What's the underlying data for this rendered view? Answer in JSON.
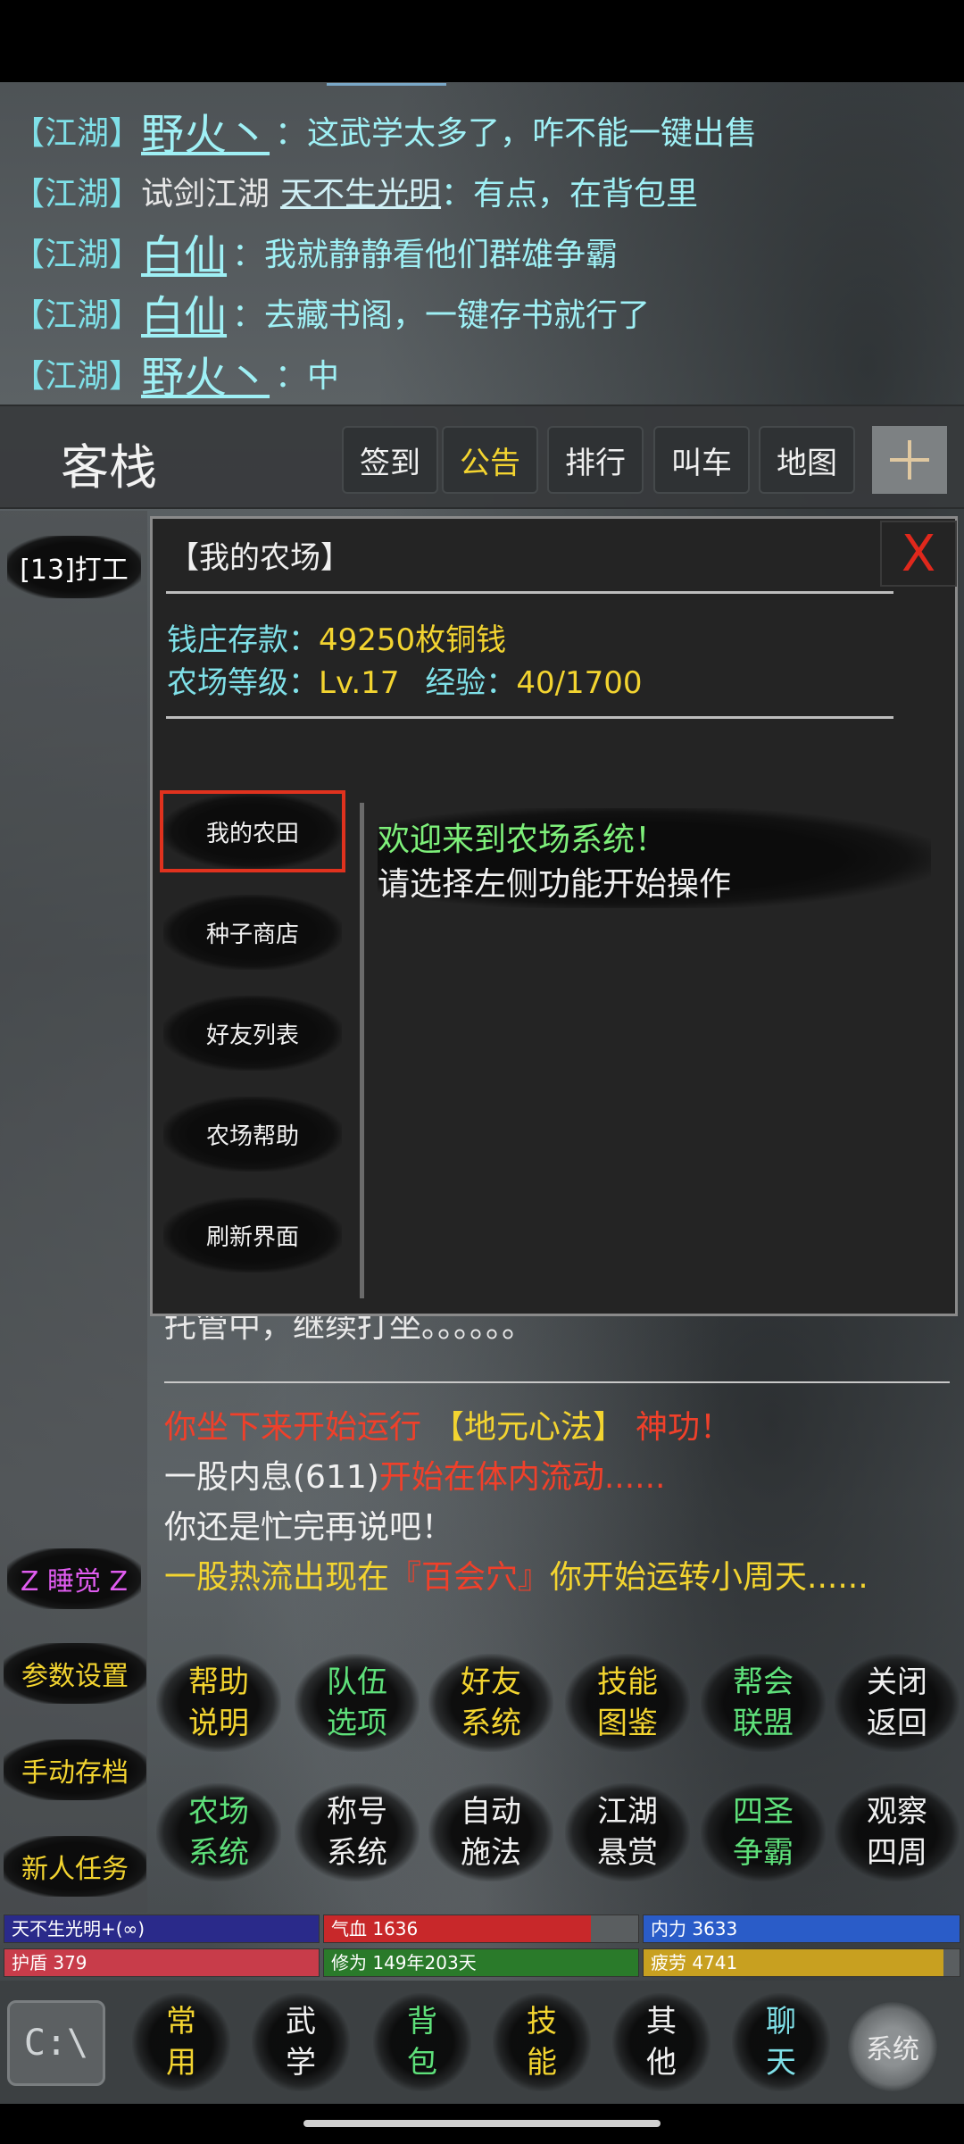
{
  "chat": [
    {
      "channel": "【江湖】",
      "name": "野火丶",
      "message": "：这武学太多了，咋不能一键出售"
    },
    {
      "channel": "【江湖】",
      "prefix": "试剑江湖",
      "name": "天不生光明",
      "message": "：有点，在背包里"
    },
    {
      "channel": "【江湖】",
      "name": "白仙",
      "message": "：我就静静看他们群雄争霸"
    },
    {
      "channel": "【江湖】",
      "name": "白仙",
      "message": "：去藏书阁，一键存书就行了"
    },
    {
      "channel": "【江湖】",
      "name": "野火丶",
      "message": "：中"
    }
  ],
  "topnav": {
    "title": "客栈",
    "buttons": [
      "签到",
      "公告",
      "排行",
      "叫车",
      "地图"
    ],
    "active": "公告"
  },
  "side": {
    "work": "[13]打工",
    "sleep": "Z 睡觉 Z",
    "params": "参数设置",
    "save": "手动存档",
    "tasks": "新人任务"
  },
  "log": {
    "line1": "托管中，继续打坐。。。。。。",
    "row1": {
      "a": "你坐下来开始运行",
      "b": "【地元心法】",
      "c": "神功！"
    },
    "row2": {
      "a": "一股内息(611)",
      "b": "开始在体内流动......"
    },
    "row3": "你还是忙完再说吧！",
    "row4": {
      "a": "一股热流出现在",
      "b": "『百会穴』",
      "c": "你开始运转小周天......"
    }
  },
  "grid": [
    {
      "top": "帮助",
      "bottom": "说明",
      "color": "yellow"
    },
    {
      "top": "队伍",
      "bottom": "选项",
      "color": "green"
    },
    {
      "top": "好友",
      "bottom": "系统",
      "color": "yellow"
    },
    {
      "top": "技能",
      "bottom": "图鉴",
      "color": "yellow"
    },
    {
      "top": "帮会",
      "bottom": "联盟",
      "color": "green"
    },
    {
      "top": "关闭",
      "bottom": "返回",
      "color": "white"
    },
    {
      "top": "农场",
      "bottom": "系统",
      "color": "green"
    },
    {
      "top": "称号",
      "bottom": "系统",
      "color": "white"
    },
    {
      "top": "自动",
      "bottom": "施法",
      "color": "white"
    },
    {
      "top": "江湖",
      "bottom": "悬赏",
      "color": "white"
    },
    {
      "top": "四圣",
      "bottom": "争霸",
      "color": "green"
    },
    {
      "top": "观察",
      "bottom": "四周",
      "color": "white"
    }
  ],
  "stats": {
    "name": "天不生光明+(∞)",
    "qixue": "气血 1636",
    "qixue_fill": 0.85,
    "neili": "内力 3633",
    "hudun": "护盾 379",
    "xiuwei": "修为 149年203天",
    "pilao": "疲劳 4741",
    "pilao_fill": 0.95,
    "colors": {
      "name": "#2a2a8a",
      "qixue": "#c8282a",
      "neili": "#2a5cc8",
      "hudun": "#c83c4a",
      "xiuwei": "#2a7a2a",
      "pilao": "#c8a020"
    }
  },
  "bottomnav": {
    "cmd": "C:\\",
    "items": [
      {
        "top": "常",
        "bottom": "用",
        "color": "yellow"
      },
      {
        "top": "武",
        "bottom": "学",
        "color": "white"
      },
      {
        "top": "背",
        "bottom": "包",
        "color": "green"
      },
      {
        "top": "技",
        "bottom": "能",
        "color": "yellow"
      },
      {
        "top": "其",
        "bottom": "他",
        "color": "white"
      },
      {
        "top": "聊",
        "bottom": "天",
        "color": "cyan"
      }
    ],
    "gear": "系统"
  },
  "modal": {
    "title": "【我的农场】",
    "close": "X",
    "bank_label": "钱庄存款：",
    "bank_value": "49250枚铜钱",
    "level_label": "农场等级：",
    "level_value": "Lv.17",
    "exp_label": "经验：",
    "exp_value": "40/1700",
    "menu": [
      "我的农田",
      "种子商店",
      "好友列表",
      "农场帮助",
      "刷新界面"
    ],
    "selected": "我的农田",
    "welcome": "欢迎来到农场系统！",
    "instruction": "请选择左侧功能开始操作"
  }
}
